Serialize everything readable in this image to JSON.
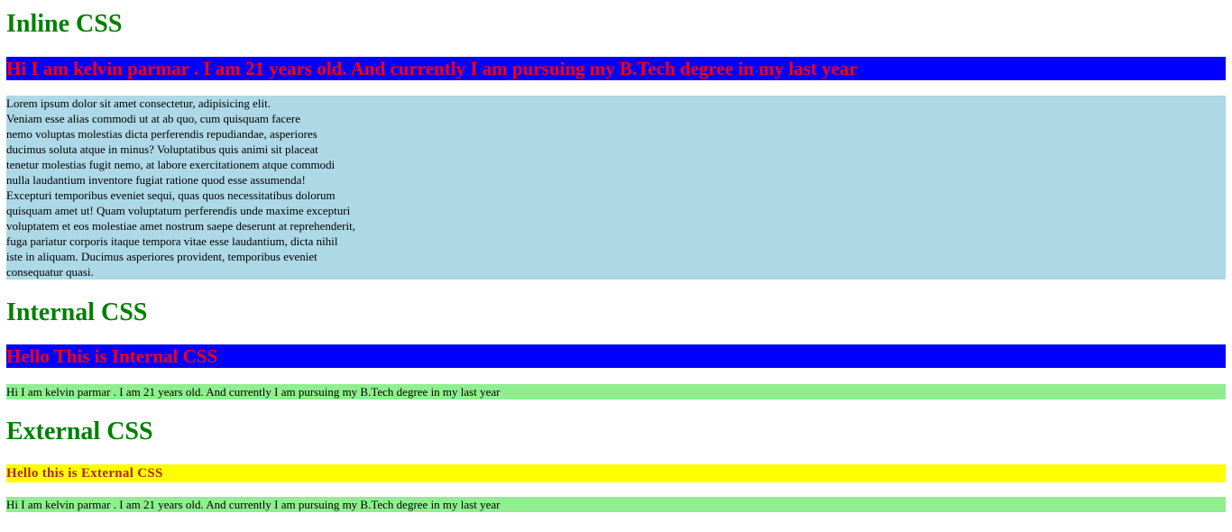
{
  "inline": {
    "heading": "Inline CSS",
    "banner": "Hi I am kelvin parmar . I am 21 years old. And currently I am pursuing my B.Tech degree in my last year",
    "paragraph_lines": [
      "Lorem ipsum dolor sit amet consectetur, adipisicing elit.",
      "Veniam esse alias commodi ut at ab quo, cum quisquam facere",
      "nemo voluptas molestias dicta perferendis repudiandae, asperiores",
      "ducimus soluta atque in minus? Voluptatibus quis animi sit placeat",
      "tenetur molestias fugit nemo, at labore exercitationem atque commodi",
      "nulla laudantium inventore fugiat ratione quod esse assumenda!",
      "Excepturi temporibus eveniet sequi, quas quos necessitatibus dolorum",
      "quisquam amet ut! Quam voluptatum perferendis unde maxime excepturi",
      "voluptatem et eos molestiae amet nostrum saepe deserunt at reprehenderit,",
      "fuga pariatur corporis itaque tempora vitae esse laudantium, dicta nihil",
      "iste in aliquam. Ducimus asperiores provident, temporibus eveniet",
      "consequatur quasi."
    ]
  },
  "internal": {
    "heading": "Internal CSS",
    "banner": "Hello This is Internal CSS",
    "text": "Hi I am kelvin parmar . I am 21 years old. And currently I am pursuing my B.Tech degree in my last year"
  },
  "external": {
    "heading": "External CSS",
    "banner": "Hello this is External CSS",
    "text": "Hi I am kelvin parmar . I am 21 years old. And currently I am pursuing my B.Tech degree in my last year"
  },
  "colors": {
    "heading": "#008000",
    "banner_bg": "#0000ff",
    "banner_text": "#ff0000",
    "paragraph_bg": "#add8e6",
    "text_bar_bg": "#90ee90",
    "external_banner_bg": "#ffff00",
    "external_banner_text": "#a52a2a"
  }
}
